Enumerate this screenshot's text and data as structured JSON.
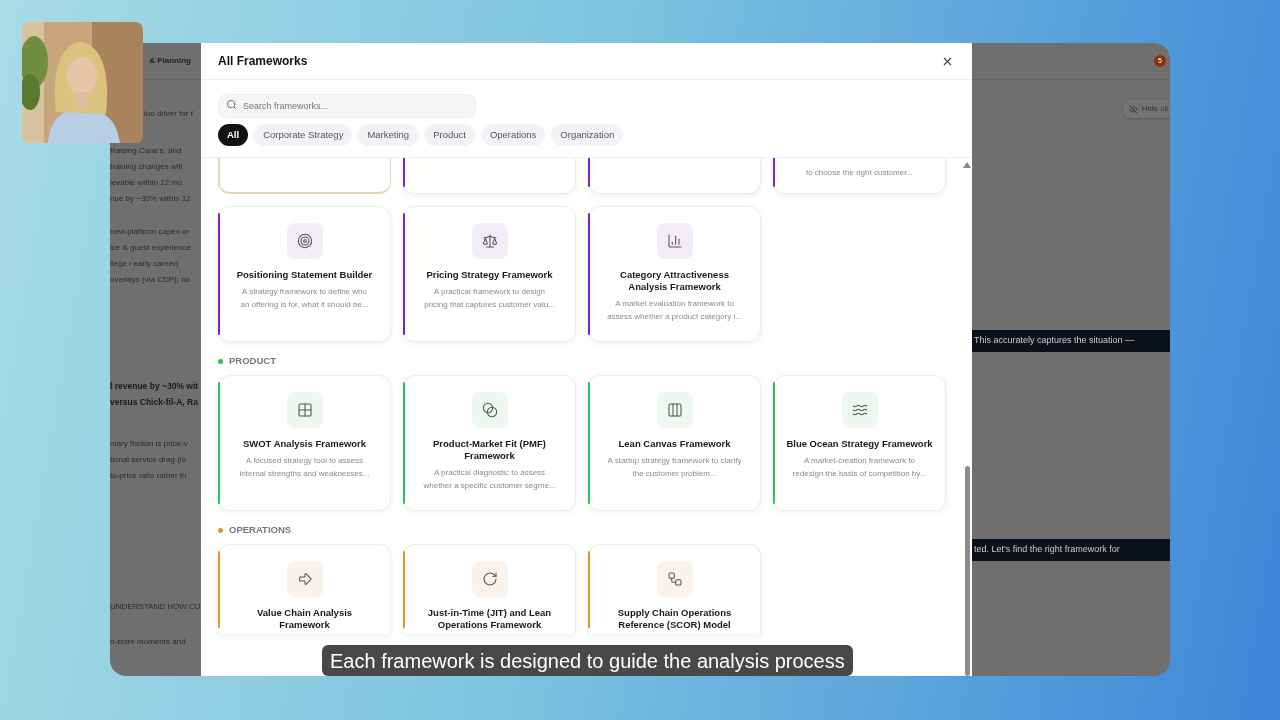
{
  "background_app": {
    "header_title": "& Planning",
    "left_blocks": [
      [
        "ion driver for f"
      ],
      [
        "Raising Cane's, and",
        "training changes will",
        "ievable within 12 mo",
        "nue by ~30% within 12"
      ],
      [
        "new-platform capex or",
        "ice & guest experience",
        "llege / early career)",
        "overlays (via CDP); no"
      ],
      [
        "l revenue by ~30% wit",
        "versus Chick-fil-A, Ra"
      ],
      [
        "mary friction is price-v",
        "tional service drag (lo",
        "to-price ratio rather th"
      ],
      [
        "UNDERSTAND HOW CU"
      ],
      [
        "n-store moments and"
      ]
    ],
    "avatar_badge": "5",
    "hide_button": "Hide cli",
    "banners": [
      "This accurately captures the situation —",
      "ted. Let's find the right framework for"
    ]
  },
  "modal": {
    "title": "All Frameworks",
    "search": {
      "placeholder": "Search frameworks..."
    },
    "filters": [
      {
        "label": "All",
        "selected": true
      },
      {
        "label": "Corporate Strategy",
        "selected": false
      },
      {
        "label": "Marketing",
        "selected": false
      },
      {
        "label": "Product",
        "selected": false
      },
      {
        "label": "Operations",
        "selected": false
      },
      {
        "label": "Organization",
        "selected": false
      }
    ],
    "partial_cards": [
      {
        "color": "#e4d6b8",
        "highlighted": true
      },
      {
        "color": "#7e22ce",
        "highlighted": false
      },
      {
        "color": "#7e22ce",
        "highlighted": false
      },
      {
        "color": "#7e22ce",
        "highlighted": false,
        "description": "to choose the right customer..."
      }
    ],
    "sections": [
      {
        "color": "#7e22ce",
        "cards": [
          {
            "title": "Positioning Statement Builder",
            "description": "A strategy framework to define who an offering is for, what it should be..."
          },
          {
            "title": "Pricing Strategy Framework",
            "description": "A practical framework to design pricing that captures customer valu..."
          },
          {
            "title": "Category Attractiveness Analysis Framework",
            "description": "A market evaluation framework to assess whether a product category i..."
          }
        ]
      },
      {
        "title": "PRODUCT",
        "color": "#22c55e",
        "cards": [
          {
            "title": "SWOT Analysis Framework",
            "description": "A focused strategy tool to assess internal strengths and weaknesses..."
          },
          {
            "title": "Product-Market Fit (PMF) Framework",
            "description": "A practical diagnostic to assess whether a specific customer segme..."
          },
          {
            "title": "Lean Canvas Framework",
            "description": "A startup strategy framework to clarify the customer problem..."
          },
          {
            "title": "Blue Ocean Strategy Framework",
            "description": "A market-creation framework to redesign the basis of competition by..."
          }
        ]
      },
      {
        "title": "OPERATIONS",
        "color": "#d99a2b",
        "cards": [
          {
            "title": "Value Chain Analysis Framework"
          },
          {
            "title": "Just-in-Time (JIT) and Lean Operations Framework"
          },
          {
            "title": "Supply Chain Operations Reference (SCOR) Model"
          }
        ]
      }
    ]
  },
  "caption": "Each framework is designed to guide the analysis process"
}
